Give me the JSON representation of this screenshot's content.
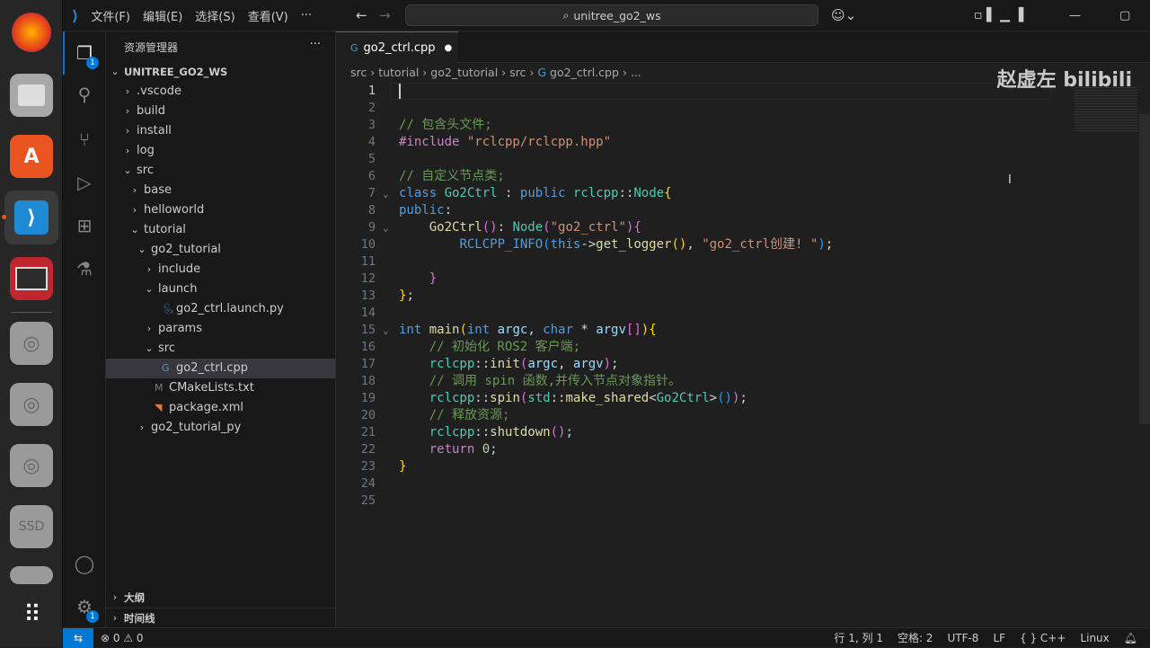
{
  "menu": [
    "文件(F)",
    "编辑(E)",
    "选择(S)",
    "查看(V)",
    "···"
  ],
  "search": "unitree_go2_ws",
  "watermark": "赵虚左 bilibili",
  "sidebar": {
    "title": "资源管理器",
    "more": "···",
    "root": "UNITREE_GO2_WS",
    "items": [
      {
        "label": ".vscode",
        "depth": 0,
        "chev": "›",
        "icon": ""
      },
      {
        "label": "build",
        "depth": 0,
        "chev": "›",
        "icon": ""
      },
      {
        "label": "install",
        "depth": 0,
        "chev": "›",
        "icon": ""
      },
      {
        "label": "log",
        "depth": 0,
        "chev": "›",
        "icon": ""
      },
      {
        "label": "src",
        "depth": 0,
        "chev": "⌄",
        "icon": ""
      },
      {
        "label": "base",
        "depth": 1,
        "chev": "›",
        "icon": ""
      },
      {
        "label": "helloworld",
        "depth": 1,
        "chev": "›",
        "icon": ""
      },
      {
        "label": "tutorial",
        "depth": 1,
        "chev": "⌄",
        "icon": ""
      },
      {
        "label": "go2_tutorial",
        "depth": 2,
        "chev": "⌄",
        "icon": ""
      },
      {
        "label": "include",
        "depth": 3,
        "chev": "›",
        "icon": ""
      },
      {
        "label": "launch",
        "depth": 3,
        "chev": "⌄",
        "icon": ""
      },
      {
        "label": "go2_ctrl.launch.py",
        "depth": 4,
        "chev": "",
        "icon": "python"
      },
      {
        "label": "params",
        "depth": 3,
        "chev": "›",
        "icon": ""
      },
      {
        "label": "src",
        "depth": 3,
        "chev": "⌄",
        "icon": ""
      },
      {
        "label": "go2_ctrl.cpp",
        "depth": 4,
        "chev": "",
        "icon": "cpp",
        "selected": true
      },
      {
        "label": "CMakeLists.txt",
        "depth": 3,
        "chev": "",
        "icon": "cmake"
      },
      {
        "label": "package.xml",
        "depth": 3,
        "chev": "",
        "icon": "xml"
      },
      {
        "label": "go2_tutorial_py",
        "depth": 2,
        "chev": "›",
        "icon": ""
      }
    ],
    "outline": "大纲",
    "timeline": "时间线"
  },
  "tab": {
    "label": "go2_ctrl.cpp"
  },
  "breadcrumb": [
    "src",
    "tutorial",
    "go2_tutorial",
    "src",
    "go2_ctrl.cpp",
    "..."
  ],
  "code": [
    [],
    [],
    [
      [
        "// 包含头文件;",
        "cm"
      ]
    ],
    [
      [
        "#include ",
        "pp"
      ],
      [
        "\"rclcpp/rclcpp.hpp\"",
        "str"
      ]
    ],
    [],
    [
      [
        "// 自定义节点类;",
        "cm"
      ]
    ],
    [
      [
        "class ",
        "kw"
      ],
      [
        "Go2Ctrl",
        "ty"
      ],
      [
        " : ",
        "pl"
      ],
      [
        "public ",
        "kw"
      ],
      [
        "rclcpp",
        "ty"
      ],
      [
        "::",
        "pl"
      ],
      [
        "Node",
        "ty"
      ],
      [
        "{",
        "b1"
      ]
    ],
    [
      [
        "public",
        "kw"
      ],
      [
        ":",
        "pl"
      ]
    ],
    [
      [
        "    ",
        "pl"
      ],
      [
        "Go2Ctrl",
        "fn"
      ],
      [
        "()",
        "b2"
      ],
      [
        ": ",
        "pl"
      ],
      [
        "Node",
        "ty"
      ],
      [
        "(",
        "b2"
      ],
      [
        "\"go2_ctrl\"",
        "str"
      ],
      [
        ")",
        "b2"
      ],
      [
        "{",
        "b2"
      ]
    ],
    [
      [
        "        ",
        "pl"
      ],
      [
        "RCLCPP_INFO",
        "mac"
      ],
      [
        "(",
        "b3"
      ],
      [
        "this",
        "kw"
      ],
      [
        "->",
        "pl"
      ],
      [
        "get_logger",
        "fn"
      ],
      [
        "()",
        "b1"
      ],
      [
        ", ",
        "pl"
      ],
      [
        "\"go2_ctrl创建! \"",
        "str"
      ],
      [
        ")",
        "b3"
      ],
      [
        ";",
        "pl"
      ]
    ],
    [],
    [
      [
        "    ",
        "pl"
      ],
      [
        "}",
        "b2"
      ]
    ],
    [
      [
        "}",
        "b1"
      ],
      [
        ";",
        "pl"
      ]
    ],
    [],
    [
      [
        "int ",
        "kw"
      ],
      [
        "main",
        "fn"
      ],
      [
        "(",
        "b1"
      ],
      [
        "int ",
        "kw"
      ],
      [
        "argc",
        "var"
      ],
      [
        ", ",
        "pl"
      ],
      [
        "char ",
        "kw"
      ],
      [
        "* ",
        "pl"
      ],
      [
        "argv",
        "var"
      ],
      [
        "[]",
        "b2"
      ],
      [
        ")",
        "b1"
      ],
      [
        "{",
        "b1"
      ]
    ],
    [
      [
        "    ",
        "pl"
      ],
      [
        "// 初始化 ROS2 客户端;",
        "cm"
      ]
    ],
    [
      [
        "    ",
        "pl"
      ],
      [
        "rclcpp",
        "ty"
      ],
      [
        "::",
        "pl"
      ],
      [
        "init",
        "fn"
      ],
      [
        "(",
        "b2"
      ],
      [
        "argc",
        "var"
      ],
      [
        ", ",
        "pl"
      ],
      [
        "argv",
        "var"
      ],
      [
        ")",
        "b2"
      ],
      [
        ";",
        "pl"
      ]
    ],
    [
      [
        "    ",
        "pl"
      ],
      [
        "// 调用 spin 函数,并传入节点对象指针。",
        "cm"
      ]
    ],
    [
      [
        "    ",
        "pl"
      ],
      [
        "rclcpp",
        "ty"
      ],
      [
        "::",
        "pl"
      ],
      [
        "spin",
        "fn"
      ],
      [
        "(",
        "b2"
      ],
      [
        "std",
        "ty"
      ],
      [
        "::",
        "pl"
      ],
      [
        "make_shared",
        "fn"
      ],
      [
        "<",
        "pl"
      ],
      [
        "Go2Ctrl",
        "ty"
      ],
      [
        ">",
        "pl"
      ],
      [
        "()",
        "b3"
      ],
      [
        ")",
        "b2"
      ],
      [
        ";",
        "pl"
      ]
    ],
    [
      [
        "    ",
        "pl"
      ],
      [
        "// 释放资源;",
        "cm"
      ]
    ],
    [
      [
        "    ",
        "pl"
      ],
      [
        "rclcpp",
        "ty"
      ],
      [
        "::",
        "pl"
      ],
      [
        "shutdown",
        "fn"
      ],
      [
        "()",
        "b2"
      ],
      [
        ";",
        "pl"
      ]
    ],
    [
      [
        "    ",
        "pl"
      ],
      [
        "return ",
        "pp"
      ],
      [
        "0",
        "num"
      ],
      [
        ";",
        "pl"
      ]
    ],
    [
      [
        "}",
        "b1"
      ]
    ],
    [],
    []
  ],
  "status": {
    "errors": "0",
    "warnings": "0",
    "position": "行 1, 列 1",
    "spaces": "空格: 2",
    "encoding": "UTF-8",
    "eol": "LF",
    "language": "{ } C++",
    "platform": "Linux"
  },
  "badges": {
    "explorer": "1",
    "settings": "1"
  },
  "dock_ssd": "SSD"
}
